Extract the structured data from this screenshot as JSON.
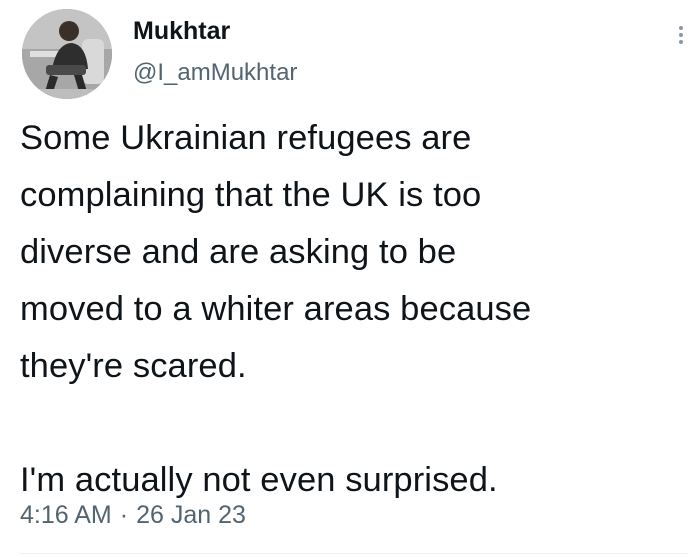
{
  "tweet": {
    "author": {
      "display_name": "Mukhtar",
      "handle": "@I_amMukhtar",
      "avatar_icon": "user-photo"
    },
    "body": {
      "paragraph_1": "Some Ukrainian refugees are\ncomplaining that the UK is too\ndiverse and are asking to be\nmoved to a whiter areas because\nthey're scared.",
      "paragraph_2": "I'm actually not even surprised."
    },
    "time": "4:16 AM",
    "separator": "·",
    "date": "26 Jan 23",
    "more_icon": "more-vertical-icon"
  },
  "colors": {
    "text_primary": "#0f1419",
    "text_secondary": "#536471",
    "background": "#ffffff"
  }
}
